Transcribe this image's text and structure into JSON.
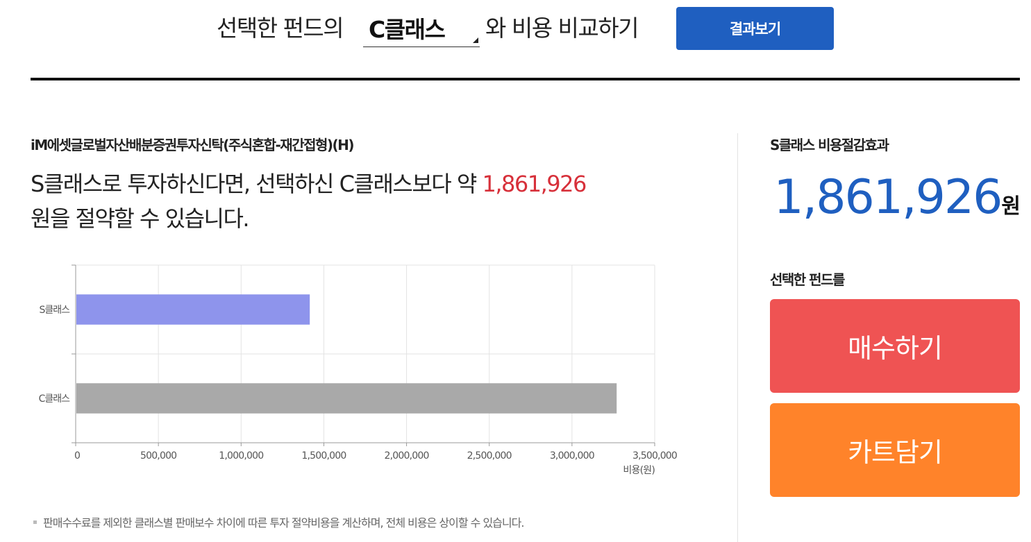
{
  "compare": {
    "prefix": "선택한 펀드의",
    "selected_class": "C클래스",
    "suffix": "와 비용 비교하기",
    "result_button": "결과보기"
  },
  "fund": {
    "name": "iM에셋글로벌자산배분증권투자신탁(주식혼합-재간접형)(H)",
    "message_before": "S클래스로 투자하신다면, 선택하신 C클래스보다 약",
    "saving_amount": "1,861,926",
    "message_after": "원을 절약할 수 있습니다."
  },
  "chart_data": {
    "type": "bar",
    "orientation": "horizontal",
    "categories": [
      "S클래스",
      "C클래스"
    ],
    "values": [
      1415000,
      3270000
    ],
    "colors": [
      "#8e94ec",
      "#a9a9a9"
    ],
    "xlim": [
      0,
      3500000
    ],
    "xticks": [
      0,
      500000,
      1000000,
      1500000,
      2000000,
      2500000,
      3000000,
      3500000
    ],
    "xtick_labels": [
      "0",
      "500,000",
      "1,000,000",
      "1,500,000",
      "2,000,000",
      "2,500,000",
      "3,000,000",
      "3,500,000"
    ],
    "xlabel": "비용(원)",
    "grid": true
  },
  "footnote": "판매수수료를 제외한 클래스별 판매보수 차이에 따른 투자 절약비용을 계산하며, 전체 비용은 상이할 수 있습니다.",
  "effect": {
    "title": "S클래스 비용절감효과",
    "amount": "1,861,926",
    "unit": "원"
  },
  "actions": {
    "label": "선택한 펀드를",
    "buy": "매수하기",
    "cart": "카트담기"
  },
  "colors": {
    "primary": "#1f5fc0",
    "highlight": "#d7303a",
    "buy": "#ef5353",
    "cart": "#ff832a"
  }
}
